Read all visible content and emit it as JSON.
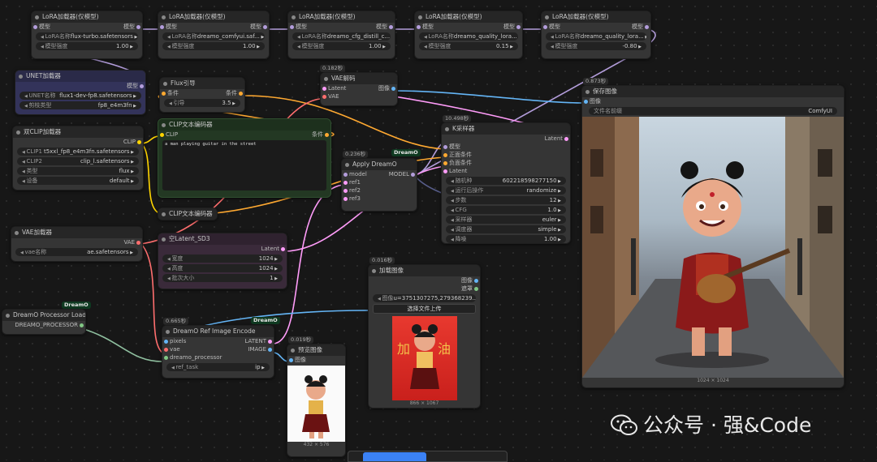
{
  "lora_nodes": [
    {
      "title": "LoRA加载器(仅模型)",
      "in": "模型",
      "out": "模型",
      "name_label": "LoRA名称",
      "name_value": "flux-turbo.safetensors",
      "strength_label": "模型强度",
      "strength_value": "1.00"
    },
    {
      "title": "LoRA加载器(仅模型)",
      "in": "模型",
      "out": "模型",
      "name_label": "LoRA名称",
      "name_value": "dreamo_comfyui.saf...",
      "strength_label": "模型强度",
      "strength_value": "1.00"
    },
    {
      "title": "LoRA加载器(仅模型)",
      "in": "模型",
      "out": "模型",
      "name_label": "LoRA名称",
      "name_value": "dreamo_cfg_distill_c...",
      "strength_label": "模型强度",
      "strength_value": "1.00"
    },
    {
      "title": "LoRA加载器(仅模型)",
      "in": "模型",
      "out": "模型",
      "name_label": "LoRA名称",
      "name_value": "dreamo_quality_lora...",
      "strength_label": "模型强度",
      "strength_value": "0.15"
    },
    {
      "title": "LoRA加载器(仅模型)",
      "in": "模型",
      "out": "模型",
      "name_label": "LoRA名称",
      "name_value": "dreamo_quality_lora...",
      "strength_label": "模型强度",
      "strength_value": "-0.80"
    }
  ],
  "unet": {
    "title": "UNET加载器",
    "out": "模型",
    "name_label": "UNET名称",
    "name_value": "flux1-dev-fp8.safetensors",
    "dtype_label": "剪枝类型",
    "dtype_value": "fp8_e4m3fn"
  },
  "flux_guide": {
    "title": "Flux引导",
    "in": "条件",
    "out": "条件",
    "guide_label": "引导",
    "guide_value": "3.5"
  },
  "vae_decode": {
    "badge": "0.182秒",
    "title": "VAE解码",
    "in1": "Latent",
    "in2": "VAE",
    "out": "图像"
  },
  "dual_clip": {
    "title": "双CLIP加载器",
    "out": "CLIP",
    "clip1_label": "CLIP1",
    "clip1_value": "t5xxl_fp8_e4m3fn.safetensors",
    "clip2_label": "CLIP2",
    "clip2_value": "clip_l.safetensors",
    "type_label": "类型",
    "type_value": "flux",
    "device_label": "设备",
    "device_value": "default"
  },
  "clip_text": {
    "title": "CLIP文本编码器",
    "in": "CLIP",
    "out": "条件",
    "text": "a man playing guitar in the street"
  },
  "clip_text_collapsed": {
    "title": "CLIP文本编码器"
  },
  "apply_dreamo": {
    "badge": "0.236秒",
    "tag": "DreamO",
    "title": "Apply DreamO",
    "in_model": "model",
    "in_ref1": "ref1",
    "in_ref2": "ref2",
    "in_ref3": "ref3",
    "out": "MODEL"
  },
  "ksampler": {
    "badge": "10.498秒",
    "title": "K采样器",
    "out": "Latent",
    "in_model": "模型",
    "in_pos": "正面条件",
    "in_neg": "负面条件",
    "in_lat": "Latent",
    "widgets": [
      {
        "label": "随机种",
        "value": "602218598277150"
      },
      {
        "label": "运行后操作",
        "value": "randomize"
      },
      {
        "label": "步数",
        "value": "12"
      },
      {
        "label": "CFG",
        "value": "1.0"
      },
      {
        "label": "采样器",
        "value": "euler"
      },
      {
        "label": "调度器",
        "value": "simple"
      },
      {
        "label": "降噪",
        "value": "1.00"
      }
    ]
  },
  "save_image": {
    "badge": "0.873秒",
    "title": "保存图像",
    "in": "图像",
    "prefix_label": "文件名前缀",
    "prefix_value": "ComfyUI",
    "caption": "1024 × 1024"
  },
  "vae_loader": {
    "title": "VAE加载器",
    "out": "VAE",
    "name_label": "vae名称",
    "name_value": "ae.safetensors"
  },
  "empty_latent": {
    "title": "空Latent_SD3",
    "out": "Latent",
    "w_label": "宽度",
    "w_value": "1024",
    "h_label": "高度",
    "h_value": "1024",
    "b_label": "批次大小",
    "b_value": "1"
  },
  "load_image": {
    "badge": "0.016秒",
    "title": "加载图像",
    "out1": "图像",
    "out2": "遮罩",
    "img_label": "图像",
    "img_value": "u=3751307275,279368239...",
    "upload": "选择文件上传",
    "caption": "866 × 1067"
  },
  "processor": {
    "tag": "DreamO",
    "title": "DreamO Processor Loader",
    "out": "DREAMO_PROCESSOR"
  },
  "ref_encode": {
    "badge": "0.665秒",
    "tag": "DreamO",
    "title": "DreamO Ref Image Encode",
    "out1": "LATENT",
    "out2": "IMAGE",
    "in_pixels": "pixels",
    "in_vae": "vae",
    "in_proc": "dreamo_processor",
    "task_label": "ref_task",
    "task_value": "ip"
  },
  "preview": {
    "badge": "0.019秒",
    "title": "预览图像",
    "in": "图像",
    "caption": "432 × 576"
  },
  "watermark": {
    "text": "公众号 · 强&Code"
  },
  "colors": {
    "model": "#b39ddb",
    "clip": "#ffd500",
    "vae": "#ff6e6e",
    "cond": "#ffa931",
    "latent": "#ff9cf9",
    "image": "#64b5f6",
    "mask": "#81c784"
  }
}
